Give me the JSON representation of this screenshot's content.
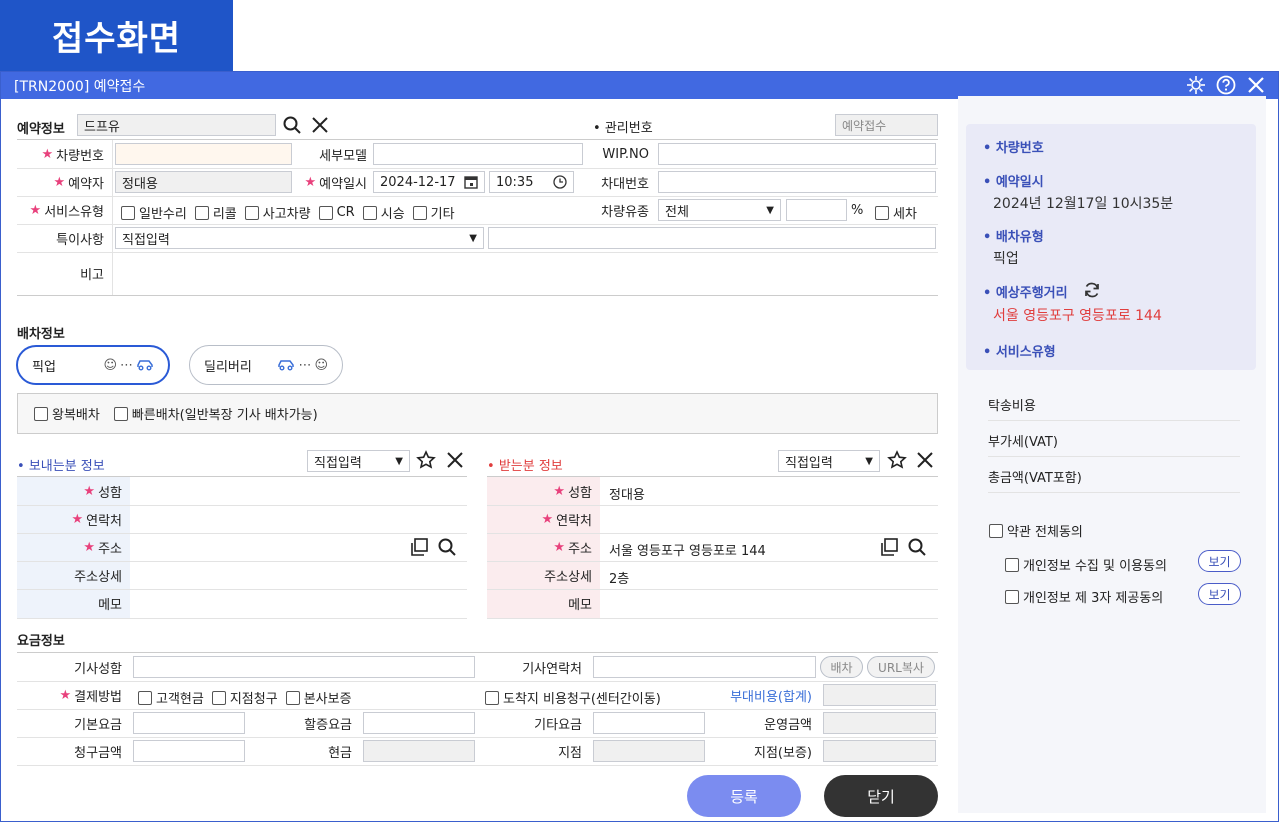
{
  "badge": "접수화면",
  "window": {
    "title": "[TRN2000] 예약접수"
  },
  "reserve": {
    "section_label": "예약정보",
    "search_value": "드프유",
    "mgmt_label": "관리번호",
    "mgmt_value": "예약접수",
    "car_no_label": "차량번호",
    "detail_model_label": "세부모델",
    "wip_label": "WIP.NO",
    "reserver_label": "예약자",
    "reserver_value": "정대용",
    "datetime_label": "예약일시",
    "date_value": "2024-12-17",
    "time_value": "10:35",
    "chassis_label": "차대번호",
    "service_label": "서비스유형",
    "services": [
      "일반수리",
      "리콜",
      "사고차량",
      "CR",
      "시승",
      "기타"
    ],
    "car_type_label": "차량유종",
    "car_type_value": "전체",
    "percent": "%",
    "wash": "세차",
    "special_label": "특이사항",
    "special_value": "직접입력",
    "memo_label": "비고"
  },
  "dispatch": {
    "section_label": "배차정보",
    "pickup": "픽업",
    "delivery": "딜리버리",
    "round_trip": "왕복배차",
    "quick": "빠른배차(일반복장 기사 배차가능)",
    "sender_title": "보내는분 정보",
    "receiver_title": "받는분 정보",
    "direct_input": "직접입력",
    "name_label": "성함",
    "contact_label": "연락처",
    "addr_label": "주소",
    "addr_detail_label": "주소상세",
    "memo_label": "메모",
    "receiver_name": "정대용",
    "receiver_addr": "서울 영등포구 영등포로 144",
    "receiver_addr_detail": "2층"
  },
  "fee": {
    "section_label": "요금정보",
    "driver_name": "기사성함",
    "driver_contact": "기사연락처",
    "dispatch_btn": "배차",
    "url_copy_btn": "URL복사",
    "pay_method": "결제방법",
    "pay_options": [
      "고객현금",
      "지점청구",
      "본사보증"
    ],
    "dest_charge": "도착지 비용청구(센터간이동)",
    "extra_fee": "부대비용(합계)",
    "base_fee": "기본요금",
    "surcharge": "할증요금",
    "other_fee": "기타요금",
    "operating": "운영금액",
    "billing": "청구금액",
    "cash": "현금",
    "branch": "지점",
    "branch_guarantee": "지점(보증)"
  },
  "buttons": {
    "register": "등록",
    "close": "닫기"
  },
  "side": {
    "car_no": "차량번호",
    "res_datetime": "예약일시",
    "res_datetime_value": "2024년 12월17일 10시35분",
    "dispatch_type": "배차유형",
    "dispatch_type_value": "픽업",
    "distance": "예상주행거리",
    "distance_value": "서울 영등포구 영등포로 144",
    "service_type": "서비스유형",
    "delivery_fee": "탁송비용",
    "vat": "부가세(VAT)",
    "total": "총금액(VAT포함)",
    "agree_all": "약관 전체동의",
    "agree_collect": "개인정보 수집 및 이용동의",
    "agree_third": "개인정보 제 3자 제공동의",
    "view": "보기"
  },
  "colors": {
    "accent": "#4169e1",
    "badge": "#1f55c8",
    "register": "#7b8cf0",
    "close": "#333333",
    "required": "#e8417c",
    "distance": "#e03e3e"
  }
}
